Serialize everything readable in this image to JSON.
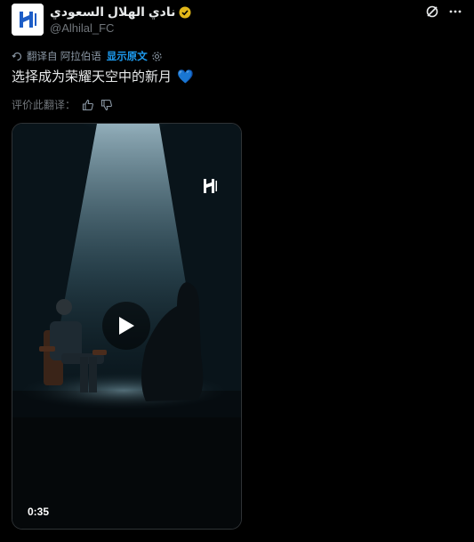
{
  "account": {
    "display_name": "نادي الهلال السعودي",
    "handle": "@Alhilal_FC",
    "avatar_icon": "alhilal-logo-icon",
    "verified_color": "#e2b719"
  },
  "actions": {
    "grok_icon": "slash-circle-icon",
    "more_icon": "more-dots-icon"
  },
  "translation": {
    "translated_from": "翻译自 阿拉伯语",
    "show_original": "显示原文"
  },
  "tweet": {
    "text": "选择成为荣耀天空中的新月",
    "emoji": "💙"
  },
  "rate": {
    "label": "评价此翻译："
  },
  "video": {
    "duration": "0:35"
  },
  "colors": {
    "background": "#000000",
    "link": "#1d9bf0",
    "secondary_text": "#71767b",
    "brand_blue": "#1d5dc7"
  }
}
